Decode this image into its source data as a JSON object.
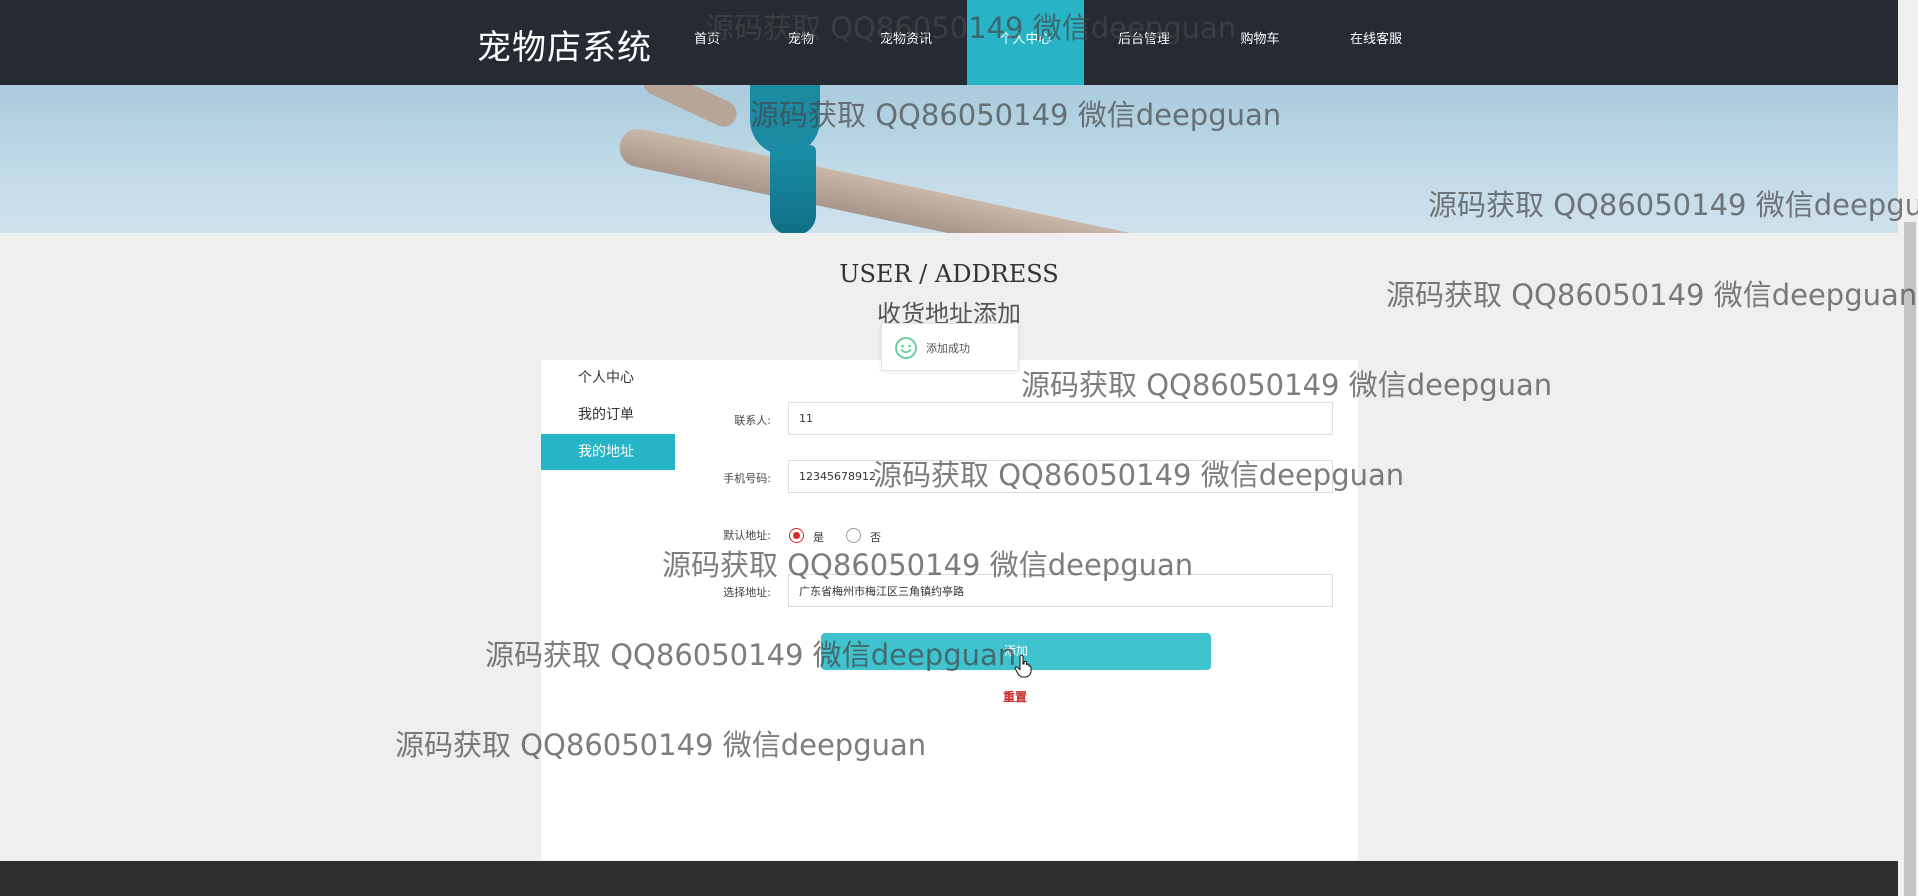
{
  "app": {
    "brand": "宠物店系统"
  },
  "nav": {
    "items": [
      {
        "label": "首页"
      },
      {
        "label": "宠物"
      },
      {
        "label": "宠物资讯"
      },
      {
        "label": "个人中心",
        "active": true
      },
      {
        "label": "后台管理"
      },
      {
        "label": "购物车"
      },
      {
        "label": "在线客服"
      }
    ]
  },
  "heading": {
    "en": "USER / ADDRESS",
    "cn": "收货地址添加"
  },
  "toast": {
    "text": "添加成功",
    "icon": "smile-icon",
    "color": "#5fcd9a"
  },
  "sidebar": {
    "items": [
      {
        "label": "个人中心"
      },
      {
        "label": "我的订单"
      },
      {
        "label": "我的地址",
        "active": true
      }
    ]
  },
  "form": {
    "contact": {
      "label": "联系人:",
      "value": "11"
    },
    "phone": {
      "label": "手机号码:",
      "value": "12345678912"
    },
    "default": {
      "label": "默认地址:",
      "yes": "是",
      "no": "否",
      "selected": "是"
    },
    "address": {
      "label": "选择地址:",
      "value": "广东省梅州市梅江区三角镇约亭路"
    },
    "submit_label": "添加",
    "reset_label": "重置"
  },
  "watermark": "源码获取 QQ86050149 微信deepguan",
  "colors": {
    "nav_bg": "#252a33",
    "accent": "#27b4c7",
    "button": "#3fc3cf",
    "danger": "#c9302c",
    "footer": "#2f2f2f"
  }
}
